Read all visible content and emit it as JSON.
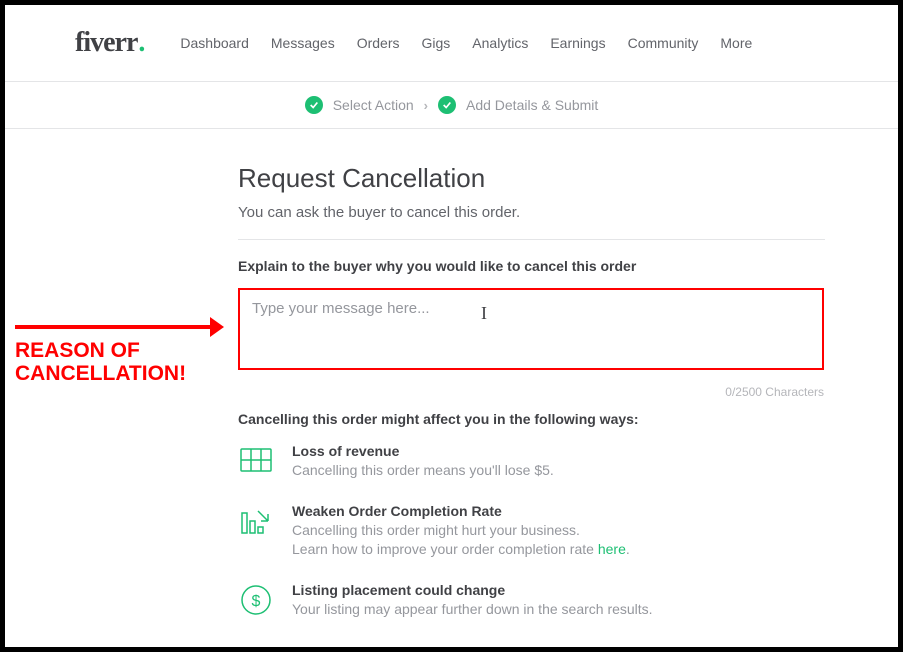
{
  "logo": "fiverr",
  "nav": {
    "items": [
      "Dashboard",
      "Messages",
      "Orders",
      "Gigs",
      "Analytics",
      "Earnings",
      "Community",
      "More"
    ]
  },
  "breadcrumb": {
    "step1": "Select Action",
    "step2": "Add Details & Submit"
  },
  "page": {
    "title": "Request Cancellation",
    "subtitle": "You can ask the buyer to cancel this order.",
    "field_label": "Explain to the buyer why you would like to cancel this order",
    "placeholder": "Type your message here...",
    "char_count": "0/2500 Characters",
    "affect_heading": "Cancelling this order might affect you in the following ways:"
  },
  "impacts": {
    "revenue": {
      "title": "Loss of revenue",
      "desc": "Cancelling this order means you'll lose $5."
    },
    "completion": {
      "title": "Weaken Order Completion Rate",
      "desc1": "Cancelling this order might hurt your business.",
      "desc2a": "Learn how to improve your order completion rate ",
      "desc2_link": "here",
      "desc2b": "."
    },
    "listing": {
      "title": "Listing placement could change",
      "desc": "Your listing may appear further down in the search results."
    }
  },
  "annotation": {
    "line1": "REASON OF",
    "line2": "CANCELLATION!"
  },
  "colors": {
    "accent": "#1dbf73",
    "red": "#ff0000"
  }
}
